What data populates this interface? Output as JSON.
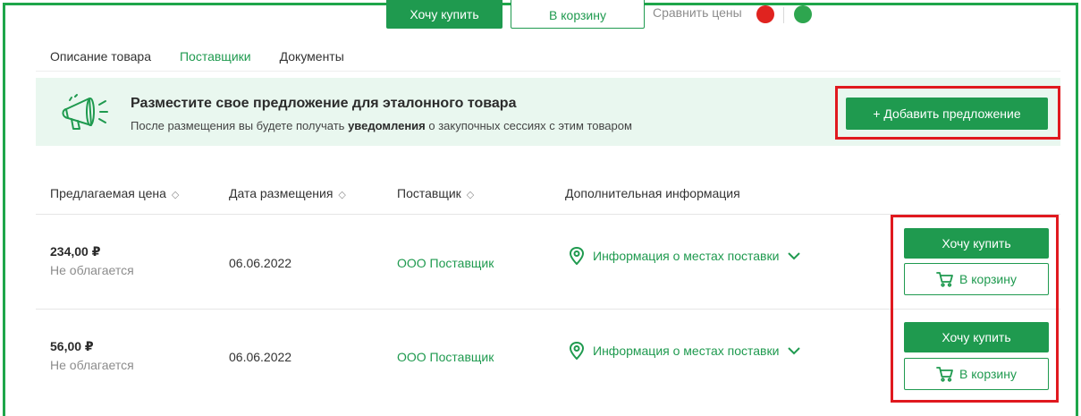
{
  "top_toolbar": {
    "buy_label": "Хочу купить",
    "cart_label": "В корзину",
    "compare_label": "Сравнить цены"
  },
  "tabs": [
    {
      "label": "Описание товара",
      "active": false
    },
    {
      "label": "Поставщики",
      "active": true
    },
    {
      "label": "Документы",
      "active": false
    }
  ],
  "banner": {
    "title": "Разместите свое предложение для эталонного товара",
    "subtitle_before": "После размещения вы будете получать ",
    "subtitle_bold": "уведомления",
    "subtitle_after": " о закупочных сессиях с этим товаром",
    "add_button_label": "+ Добавить предложение",
    "icon": "megaphone-icon"
  },
  "table": {
    "columns": [
      {
        "label": "Предлагаемая цена",
        "sortable": true
      },
      {
        "label": "Дата размещения",
        "sortable": true
      },
      {
        "label": "Поставщик",
        "sortable": true
      },
      {
        "label": "Дополнительная информация",
        "sortable": false
      }
    ],
    "rows": [
      {
        "price": "234,00 ₽",
        "tax": "Не облагается",
        "date": "06.06.2022",
        "supplier": "ООО Поставщик",
        "info": "Информация о местах поставки",
        "buy_label": "Хочу купить",
        "cart_label": "В корзину"
      },
      {
        "price": "56,00 ₽",
        "tax": "Не облагается",
        "date": "06.06.2022",
        "supplier": "ООО Поставщик",
        "info": "Информация о местах поставки",
        "buy_label": "Хочу купить",
        "cart_label": "В корзину"
      }
    ]
  },
  "colors": {
    "accent": "#1f9a4f",
    "banner_bg": "#e9f7ef",
    "highlight": "#e0191f",
    "frame": "#1ea64a"
  }
}
